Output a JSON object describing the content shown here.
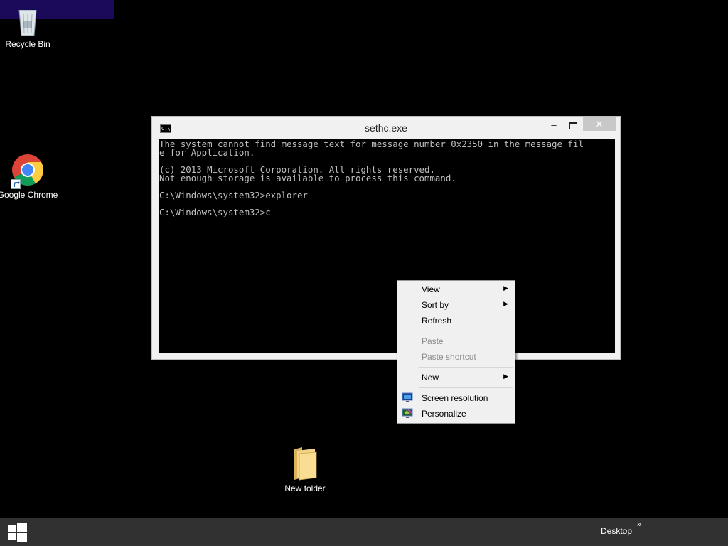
{
  "desktop": {
    "icons": [
      {
        "label": "Recycle Bin",
        "icon": "recycle-bin-icon"
      },
      {
        "label": "Google Chrome",
        "icon": "chrome-icon"
      },
      {
        "label": "New folder",
        "icon": "folder-icon"
      }
    ]
  },
  "console": {
    "title": "sethc.exe",
    "icon_label": "C:\\",
    "min_glyph": "–",
    "close_glyph": "✕",
    "lines": [
      "The system cannot find message text for message number 0x2350 in the message fil",
      "e for Application.",
      "",
      "(c) 2013 Microsoft Corporation. All rights reserved.",
      "Not enough storage is available to process this command.",
      "",
      "C:\\Windows\\system32>explorer",
      "",
      "C:\\Windows\\system32>c"
    ]
  },
  "context_menu": {
    "items": [
      {
        "label": "View",
        "submenu": true,
        "enabled": true
      },
      {
        "label": "Sort by",
        "submenu": true,
        "enabled": true
      },
      {
        "label": "Refresh",
        "submenu": false,
        "enabled": true
      },
      {
        "label": "Paste",
        "submenu": false,
        "enabled": false
      },
      {
        "label": "Paste shortcut",
        "submenu": false,
        "enabled": false
      },
      {
        "label": "New",
        "submenu": true,
        "enabled": true
      },
      {
        "label": "Screen resolution",
        "submenu": false,
        "enabled": true,
        "icon": "screen-resolution-icon"
      },
      {
        "label": "Personalize",
        "submenu": false,
        "enabled": true,
        "icon": "personalize-icon"
      }
    ],
    "submenu_arrow": "▶"
  },
  "taskbar": {
    "desktop_label": "Desktop",
    "chevron": "»",
    "background": "#313131"
  },
  "colors": {
    "desktop_bg": "#000000",
    "console_text": "#c0c0c0",
    "disabled_text": "#8d8d8d"
  }
}
